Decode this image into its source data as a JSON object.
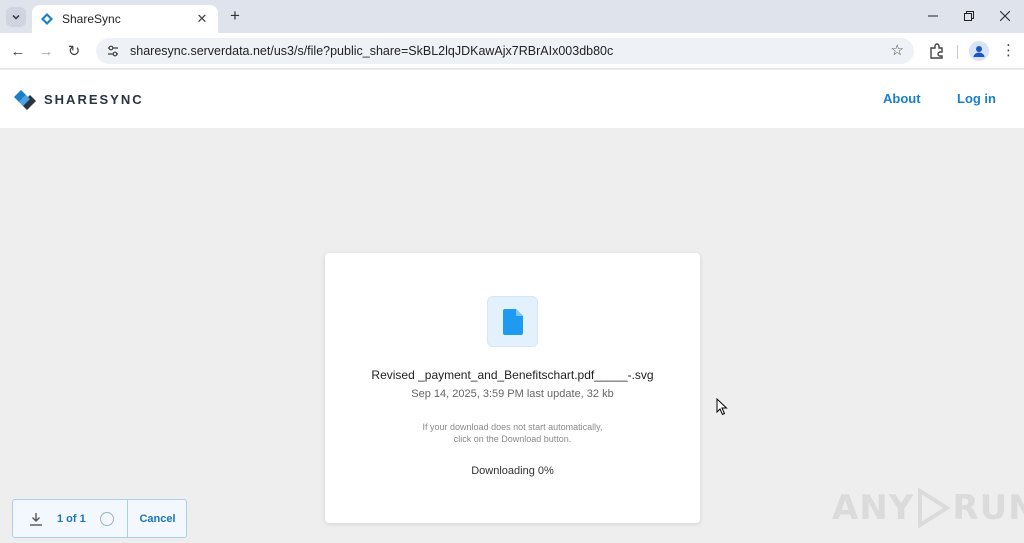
{
  "browser": {
    "tab_title": "ShareSync",
    "url": "sharesync.serverdata.net/us3/s/file?public_share=SkBL2lqJDKawAjx7RBrAIx003db80c"
  },
  "header": {
    "logo_text": "SHARESYNC",
    "nav": [
      {
        "label": "About"
      },
      {
        "label": "Log in"
      }
    ]
  },
  "file": {
    "name": "Revised _payment_and_Benefitschart.pdf_____-.svg",
    "meta": "Sep 14, 2025, 3:59 PM last update, 32 kb",
    "hint_line1": "If your download does not start automatically,",
    "hint_line2": "click on the Download button.",
    "status": "Downloading 0%"
  },
  "download_bar": {
    "count": "1 of 1",
    "cancel_label": "Cancel"
  },
  "watermark": {
    "left": "ANY",
    "right": "RUN"
  },
  "colors": {
    "accent": "#1a7fc9",
    "file_icon": "#1e9bf0",
    "background": "#eeeeee"
  },
  "icons": [
    "search-tabs-icon",
    "sharesync-favicon",
    "close-icon",
    "new-tab-icon",
    "minimize-icon",
    "restore-icon",
    "window-close-icon",
    "back-icon",
    "forward-icon",
    "reload-icon",
    "site-settings-icon",
    "bookmark-star-icon",
    "extensions-icon",
    "profile-icon",
    "menu-icon",
    "file-icon",
    "download-icon",
    "cursor-icon"
  ]
}
